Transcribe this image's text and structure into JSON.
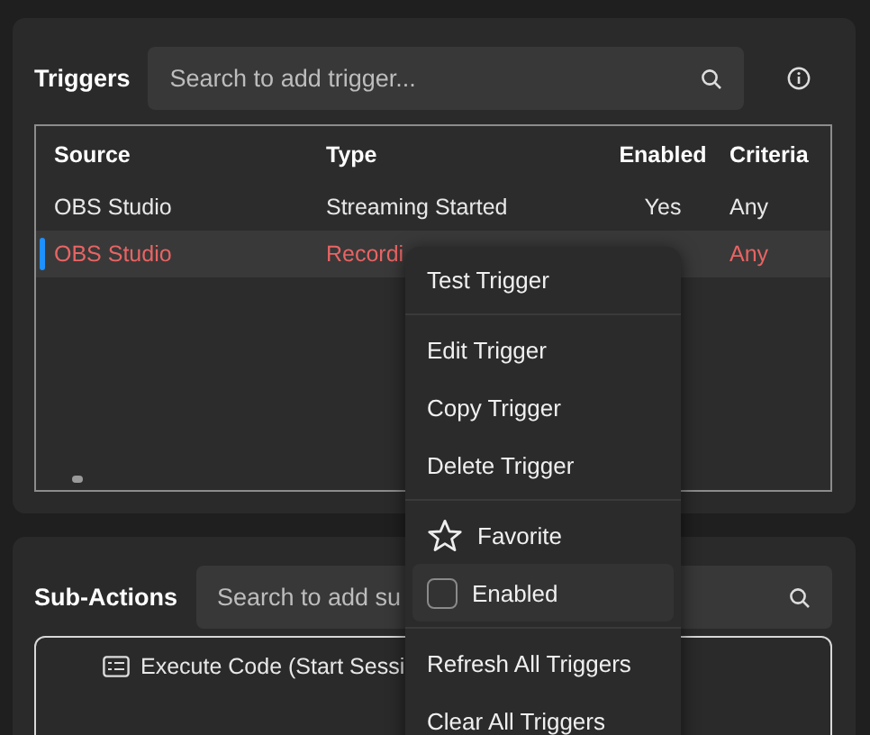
{
  "triggers": {
    "title": "Triggers",
    "search": {
      "placeholder": "Search to add trigger..."
    },
    "table": {
      "columns": [
        "Source",
        "Type",
        "Enabled",
        "Criteria"
      ],
      "rows": [
        {
          "cells": [
            "OBS Studio",
            "Streaming Started",
            "Yes",
            "Any"
          ],
          "selected": false
        },
        {
          "cells": [
            "OBS Studio",
            "Recordi",
            "",
            "Any"
          ],
          "selected": true
        }
      ]
    }
  },
  "sub_actions": {
    "title": "Sub-Actions",
    "search": {
      "placeholder": "Search to add su"
    },
    "items": [
      {
        "label": "Execute Code (Start Sessi"
      }
    ]
  },
  "context_menu": {
    "items": [
      {
        "kind": "item",
        "label": "Test Trigger"
      },
      {
        "kind": "separator"
      },
      {
        "kind": "item",
        "label": "Edit Trigger"
      },
      {
        "kind": "item",
        "label": "Copy Trigger"
      },
      {
        "kind": "item",
        "label": "Delete Trigger"
      },
      {
        "kind": "separator"
      },
      {
        "kind": "star",
        "label": "Favorite"
      },
      {
        "kind": "checkbox",
        "label": "Enabled",
        "checked": false
      },
      {
        "kind": "separator"
      },
      {
        "kind": "item",
        "label": "Refresh All Triggers"
      },
      {
        "kind": "item",
        "label": "Clear All Triggers"
      }
    ]
  }
}
